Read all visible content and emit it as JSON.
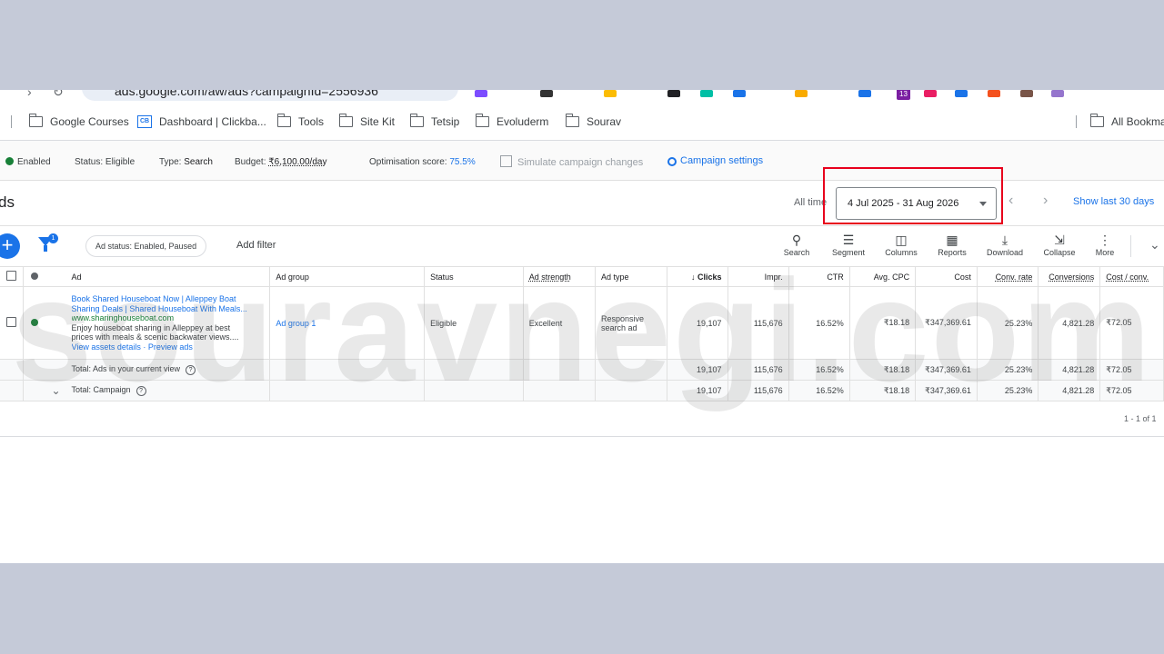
{
  "browser": {
    "url": "ads.google.com/aw/ads?campaignId=2556936",
    "bookmarks": [
      "Google Courses",
      "Dashboard | Clickba...",
      "Tools",
      "Site Kit",
      "Tetsip",
      "Evoluderm",
      "Sourav"
    ],
    "all_bookmarks": "All Bookma",
    "ext_badge": "13"
  },
  "campaign_bar": {
    "enabled": "Enabled",
    "status": "Status: Eligible",
    "type_label": "Type:",
    "type_value": "Search",
    "budget_label": "Budget:",
    "budget_value": "₹6,100.00/day",
    "opt_label": "Optimisation score:",
    "opt_value": "75.5%",
    "simulate": "Simulate campaign changes",
    "settings": "Campaign settings"
  },
  "header": {
    "title": "ds",
    "all_time": "All time",
    "date_range": "4 Jul 2025 - 31 Aug 2026",
    "show_last": "Show last 30 days"
  },
  "toolbar": {
    "filter_badge": "1",
    "chip": "Ad status: Enabled, Paused",
    "add_filter": "Add filter",
    "buttons": [
      {
        "label": "Search",
        "icon": "search-icon"
      },
      {
        "label": "Segment",
        "icon": "segment-icon"
      },
      {
        "label": "Columns",
        "icon": "columns-icon"
      },
      {
        "label": "Reports",
        "icon": "reports-icon"
      },
      {
        "label": "Download",
        "icon": "download-icon"
      },
      {
        "label": "Collapse",
        "icon": "collapse-icon"
      },
      {
        "label": "More",
        "icon": "more-icon"
      }
    ]
  },
  "table": {
    "headers": {
      "ad": "Ad",
      "ad_group": "Ad group",
      "status": "Status",
      "ad_strength": "Ad strength",
      "ad_type": "Ad type",
      "clicks": "↓ Clicks",
      "impr": "Impr.",
      "ctr": "CTR",
      "avg_cpc": "Avg. CPC",
      "cost": "Cost",
      "conv_rate": "Conv. rate",
      "conversions": "Conversions",
      "cost_conv": "Cost / conv."
    },
    "row": {
      "headline1": "Book Shared Houseboat Now | Alleppey Boat",
      "headline2": "Sharing Deals | Shared Houseboat With Meals...",
      "url": "www.sharinghouseboat.com",
      "desc1": "Enjoy houseboat sharing in Alleppey at best",
      "desc2": "prices with meals & scenic backwater views....",
      "links": "View assets details · Preview ads",
      "ad_group": "Ad group 1",
      "status": "Eligible",
      "ad_strength": "Excellent",
      "ad_type_1": "Responsive",
      "ad_type_2": "search ad",
      "clicks": "19,107",
      "impr": "115,676",
      "ctr": "16.52%",
      "avg_cpc": "₹18.18",
      "cost": "₹347,369.61",
      "conv_rate": "25.23%",
      "conversions": "4,821.28",
      "cost_conv": "₹72.05"
    },
    "total_view": {
      "label": "Total: Ads in your current view",
      "clicks": "19,107",
      "impr": "115,676",
      "ctr": "16.52%",
      "avg_cpc": "₹18.18",
      "cost": "₹347,369.61",
      "conv_rate": "25.23%",
      "conversions": "4,821.28",
      "cost_conv": "₹72.05"
    },
    "total_campaign": {
      "label": "Total: Campaign",
      "clicks": "19,107",
      "impr": "115,676",
      "ctr": "16.52%",
      "avg_cpc": "₹18.18",
      "cost": "₹347,369.61",
      "conv_rate": "25.23%",
      "conversions": "4,821.28",
      "cost_conv": "₹72.05"
    },
    "pager": "1 - 1 of 1"
  },
  "watermark": "souravnegi.com",
  "colors": {
    "accent": "#1a73e8",
    "enabled": "#188038",
    "highlight": "#e8001c",
    "backdrop": "#c5cad8"
  }
}
